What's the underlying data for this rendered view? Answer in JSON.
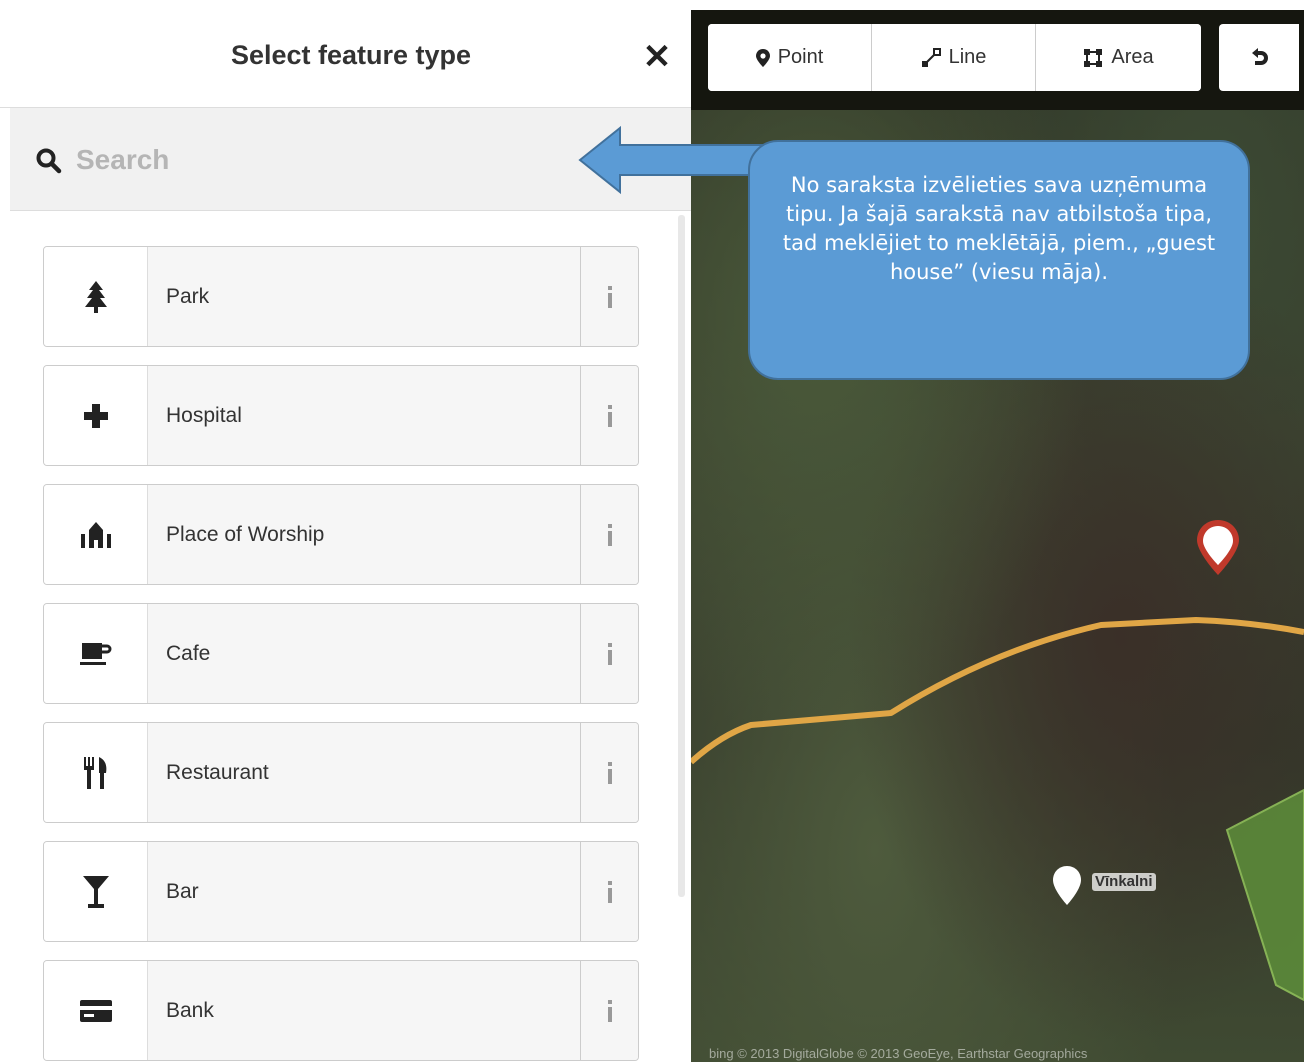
{
  "panel": {
    "title": "Select feature type",
    "close_icon": "close-icon"
  },
  "search": {
    "placeholder": "Search",
    "value": ""
  },
  "presets": [
    {
      "label": "Park",
      "icon": "tree-icon"
    },
    {
      "label": "Hospital",
      "icon": "cross-icon"
    },
    {
      "label": "Place of Worship",
      "icon": "worship-icon"
    },
    {
      "label": "Cafe",
      "icon": "cup-icon"
    },
    {
      "label": "Restaurant",
      "icon": "fork-knife-icon"
    },
    {
      "label": "Bar",
      "icon": "cocktail-icon"
    },
    {
      "label": "Bank",
      "icon": "card-icon"
    }
  ],
  "toolbar": {
    "point_label": "Point",
    "line_label": "Line",
    "area_label": "Area"
  },
  "callout": {
    "text": "No saraksta izvēlieties sava uzņēmuma tipu. Ja šajā sarakstā nav atbilstoša tipa, tad meklējiet to meklētājā, piem., „guest house” (viesu māja)."
  },
  "map": {
    "place_label": "Vīnkalni",
    "attribution": "bing © 2013 DigitalGlobe © 2013 GeoEye, Earthstar Geographics"
  },
  "colors": {
    "callout_fill": "#5b9bd5",
    "callout_border": "#41719c",
    "road": "#e0a646",
    "selected_pin": "#c0392b",
    "area_fill": "#5c8a3a"
  }
}
